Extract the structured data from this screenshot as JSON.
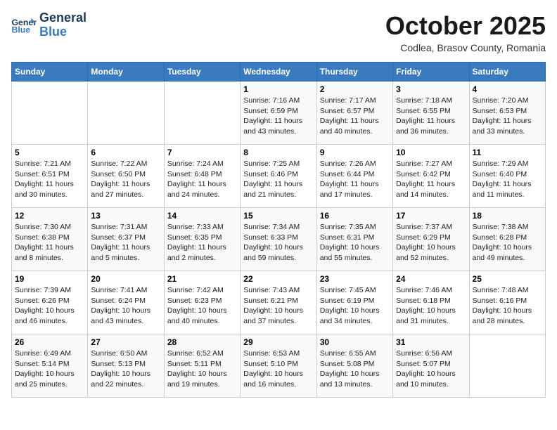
{
  "header": {
    "logo_line1": "General",
    "logo_line2": "Blue",
    "month_title": "October 2025",
    "subtitle": "Codlea, Brasov County, Romania"
  },
  "weekdays": [
    "Sunday",
    "Monday",
    "Tuesday",
    "Wednesday",
    "Thursday",
    "Friday",
    "Saturday"
  ],
  "weeks": [
    [
      {
        "day": "",
        "info": ""
      },
      {
        "day": "",
        "info": ""
      },
      {
        "day": "",
        "info": ""
      },
      {
        "day": "1",
        "info": "Sunrise: 7:16 AM\nSunset: 6:59 PM\nDaylight: 11 hours and 43 minutes."
      },
      {
        "day": "2",
        "info": "Sunrise: 7:17 AM\nSunset: 6:57 PM\nDaylight: 11 hours and 40 minutes."
      },
      {
        "day": "3",
        "info": "Sunrise: 7:18 AM\nSunset: 6:55 PM\nDaylight: 11 hours and 36 minutes."
      },
      {
        "day": "4",
        "info": "Sunrise: 7:20 AM\nSunset: 6:53 PM\nDaylight: 11 hours and 33 minutes."
      }
    ],
    [
      {
        "day": "5",
        "info": "Sunrise: 7:21 AM\nSunset: 6:51 PM\nDaylight: 11 hours and 30 minutes."
      },
      {
        "day": "6",
        "info": "Sunrise: 7:22 AM\nSunset: 6:50 PM\nDaylight: 11 hours and 27 minutes."
      },
      {
        "day": "7",
        "info": "Sunrise: 7:24 AM\nSunset: 6:48 PM\nDaylight: 11 hours and 24 minutes."
      },
      {
        "day": "8",
        "info": "Sunrise: 7:25 AM\nSunset: 6:46 PM\nDaylight: 11 hours and 21 minutes."
      },
      {
        "day": "9",
        "info": "Sunrise: 7:26 AM\nSunset: 6:44 PM\nDaylight: 11 hours and 17 minutes."
      },
      {
        "day": "10",
        "info": "Sunrise: 7:27 AM\nSunset: 6:42 PM\nDaylight: 11 hours and 14 minutes."
      },
      {
        "day": "11",
        "info": "Sunrise: 7:29 AM\nSunset: 6:40 PM\nDaylight: 11 hours and 11 minutes."
      }
    ],
    [
      {
        "day": "12",
        "info": "Sunrise: 7:30 AM\nSunset: 6:38 PM\nDaylight: 11 hours and 8 minutes."
      },
      {
        "day": "13",
        "info": "Sunrise: 7:31 AM\nSunset: 6:37 PM\nDaylight: 11 hours and 5 minutes."
      },
      {
        "day": "14",
        "info": "Sunrise: 7:33 AM\nSunset: 6:35 PM\nDaylight: 11 hours and 2 minutes."
      },
      {
        "day": "15",
        "info": "Sunrise: 7:34 AM\nSunset: 6:33 PM\nDaylight: 10 hours and 59 minutes."
      },
      {
        "day": "16",
        "info": "Sunrise: 7:35 AM\nSunset: 6:31 PM\nDaylight: 10 hours and 55 minutes."
      },
      {
        "day": "17",
        "info": "Sunrise: 7:37 AM\nSunset: 6:29 PM\nDaylight: 10 hours and 52 minutes."
      },
      {
        "day": "18",
        "info": "Sunrise: 7:38 AM\nSunset: 6:28 PM\nDaylight: 10 hours and 49 minutes."
      }
    ],
    [
      {
        "day": "19",
        "info": "Sunrise: 7:39 AM\nSunset: 6:26 PM\nDaylight: 10 hours and 46 minutes."
      },
      {
        "day": "20",
        "info": "Sunrise: 7:41 AM\nSunset: 6:24 PM\nDaylight: 10 hours and 43 minutes."
      },
      {
        "day": "21",
        "info": "Sunrise: 7:42 AM\nSunset: 6:23 PM\nDaylight: 10 hours and 40 minutes."
      },
      {
        "day": "22",
        "info": "Sunrise: 7:43 AM\nSunset: 6:21 PM\nDaylight: 10 hours and 37 minutes."
      },
      {
        "day": "23",
        "info": "Sunrise: 7:45 AM\nSunset: 6:19 PM\nDaylight: 10 hours and 34 minutes."
      },
      {
        "day": "24",
        "info": "Sunrise: 7:46 AM\nSunset: 6:18 PM\nDaylight: 10 hours and 31 minutes."
      },
      {
        "day": "25",
        "info": "Sunrise: 7:48 AM\nSunset: 6:16 PM\nDaylight: 10 hours and 28 minutes."
      }
    ],
    [
      {
        "day": "26",
        "info": "Sunrise: 6:49 AM\nSunset: 5:14 PM\nDaylight: 10 hours and 25 minutes."
      },
      {
        "day": "27",
        "info": "Sunrise: 6:50 AM\nSunset: 5:13 PM\nDaylight: 10 hours and 22 minutes."
      },
      {
        "day": "28",
        "info": "Sunrise: 6:52 AM\nSunset: 5:11 PM\nDaylight: 10 hours and 19 minutes."
      },
      {
        "day": "29",
        "info": "Sunrise: 6:53 AM\nSunset: 5:10 PM\nDaylight: 10 hours and 16 minutes."
      },
      {
        "day": "30",
        "info": "Sunrise: 6:55 AM\nSunset: 5:08 PM\nDaylight: 10 hours and 13 minutes."
      },
      {
        "day": "31",
        "info": "Sunrise: 6:56 AM\nSunset: 5:07 PM\nDaylight: 10 hours and 10 minutes."
      },
      {
        "day": "",
        "info": ""
      }
    ]
  ]
}
